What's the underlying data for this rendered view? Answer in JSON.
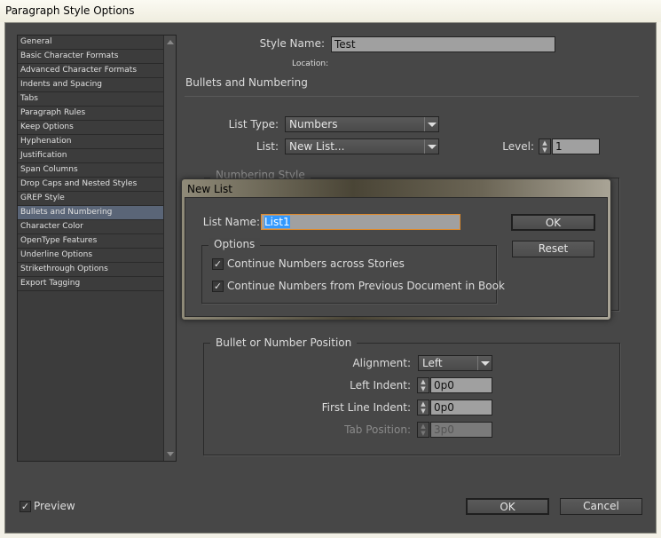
{
  "window": {
    "title": "Paragraph Style Options"
  },
  "sidebar": {
    "items": [
      {
        "label": "General"
      },
      {
        "label": "Basic Character Formats"
      },
      {
        "label": "Advanced Character Formats"
      },
      {
        "label": "Indents and Spacing"
      },
      {
        "label": "Tabs"
      },
      {
        "label": "Paragraph Rules"
      },
      {
        "label": "Keep Options"
      },
      {
        "label": "Hyphenation"
      },
      {
        "label": "Justification"
      },
      {
        "label": "Span Columns"
      },
      {
        "label": "Drop Caps and Nested Styles"
      },
      {
        "label": "GREP Style"
      },
      {
        "label": "Bullets and Numbering",
        "selected": true
      },
      {
        "label": "Character Color"
      },
      {
        "label": "OpenType Features"
      },
      {
        "label": "Underline Options"
      },
      {
        "label": "Strikethrough Options"
      },
      {
        "label": "Export Tagging"
      }
    ]
  },
  "header": {
    "style_name_label": "Style Name:",
    "style_name_value": "Test",
    "location_label": "Location:",
    "section_title": "Bullets and Numbering"
  },
  "list": {
    "type_label": "List Type:",
    "type_value": "Numbers",
    "list_label": "List:",
    "list_value": "New List...",
    "level_label": "Level:",
    "level_value": "1"
  },
  "numbering_style": {
    "title": "Numbering Style"
  },
  "position": {
    "title": "Bullet or Number Position",
    "alignment_label": "Alignment:",
    "alignment_value": "Left",
    "left_indent_label": "Left Indent:",
    "left_indent_value": "0p0",
    "first_line_label": "First Line Indent:",
    "first_line_value": "0p0",
    "tab_position_label": "Tab Position:",
    "tab_position_value": "3p0"
  },
  "footer": {
    "preview_label": "Preview",
    "preview_checked": true,
    "ok_label": "OK",
    "cancel_label": "Cancel"
  },
  "modal": {
    "title": "New List",
    "list_name_label": "List Name:",
    "list_name_value": "List1",
    "options_title": "Options",
    "opt1_label": "Continue Numbers across Stories",
    "opt1_checked": true,
    "opt2_label": "Continue Numbers from Previous Document in Book",
    "opt2_checked": true,
    "ok_label": "OK",
    "reset_label": "Reset"
  },
  "colors": {
    "panel": "#474747",
    "selection": "#5a6577",
    "focus": "#e08a2a",
    "text_highlight": "#3399ff"
  }
}
